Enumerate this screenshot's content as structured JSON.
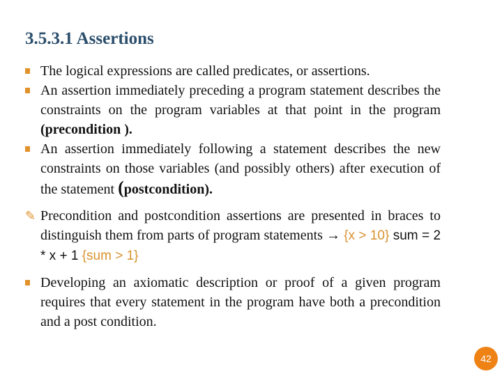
{
  "slide": {
    "title": "3.5.3.1 Assertions",
    "page_number": "42",
    "accent_color": "#ef8215",
    "title_color": "#2b4e6c",
    "bullets": [
      {
        "text": " The logical expressions are called predicates, or assertions."
      },
      {
        "text": "An assertion immediately preceding a program statement describes the constraints on the program variables at that point in the program ",
        "bold_suffix": "(precondition )."
      },
      {
        "text": "An assertion immediately following a statement describes the new constraints on those variables (and possibly others) after execution of the statement ",
        "paren": "(",
        "bold_suffix": "postcondition)."
      },
      {
        "text": "Precondition and postcondition assertions are presented in braces to distinguish them from parts of program statements ",
        "arrow": "→",
        "pre": "{x > 10}",
        "stmt": " sum = 2 * x + 1 ",
        "post": "{sum > 1}"
      },
      {
        "text": " Developing an axiomatic description or proof of a given program requires that every statement in the program have both a precondition and a post condition."
      }
    ]
  }
}
